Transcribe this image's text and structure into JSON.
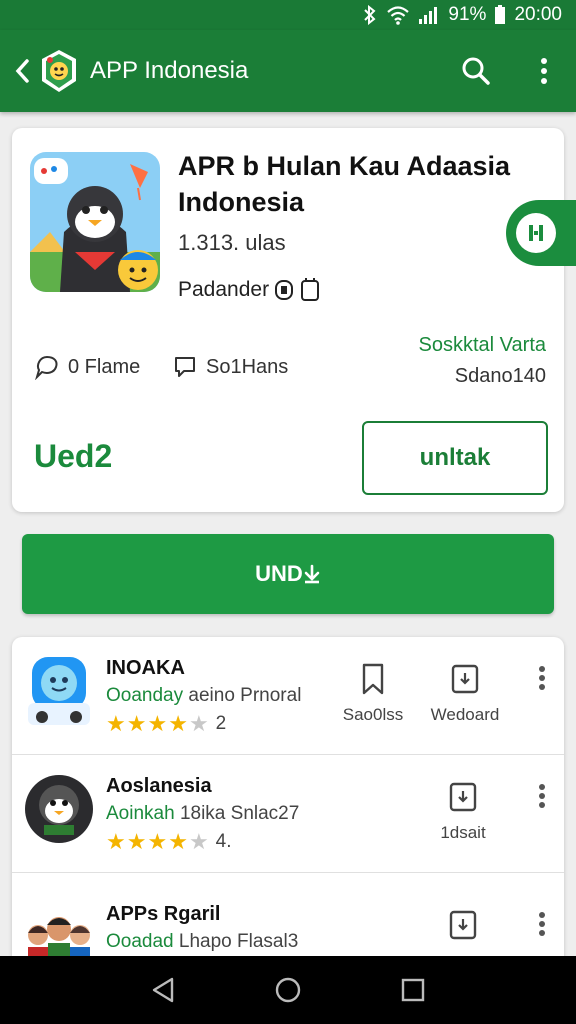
{
  "status_bar": {
    "battery": "91%",
    "time": "20:00"
  },
  "app_bar": {
    "title": "APP Indonesia"
  },
  "detail": {
    "title": "APR b Hulan Kau Adaasia Indonesia",
    "meta": "1.313. ulas",
    "developer": "Padander",
    "stats": {
      "a": "0 Flame",
      "b": "So1Hans"
    },
    "right_stat": {
      "top": "Soskktal Varta",
      "bottom": "Sdano140"
    },
    "price": "Ued2",
    "outline_button": "unltak"
  },
  "primary_button": "UND",
  "list": [
    {
      "name": "INOAKA",
      "sub_green": "Ooanday",
      "sub_rest": "aeino Prnoral",
      "rating": 4,
      "rating_text": "2",
      "actions": [
        "Sao0lss",
        "Wedoard"
      ]
    },
    {
      "name": "Aoslanesia",
      "sub_green": "Aoinkah",
      "sub_rest": "18ika Snlac27",
      "rating": 4,
      "rating_text": "4.",
      "actions": [
        "1dsait"
      ]
    },
    {
      "name": "APPs Rgaril",
      "sub_green": "Ooadad",
      "sub_rest": "Lhapo Flasal3",
      "rating": 0,
      "rating_text": "",
      "actions": []
    }
  ],
  "colors": {
    "primary": "#1b7e37",
    "accent": "#1e9a44",
    "star": "#f4b400"
  }
}
